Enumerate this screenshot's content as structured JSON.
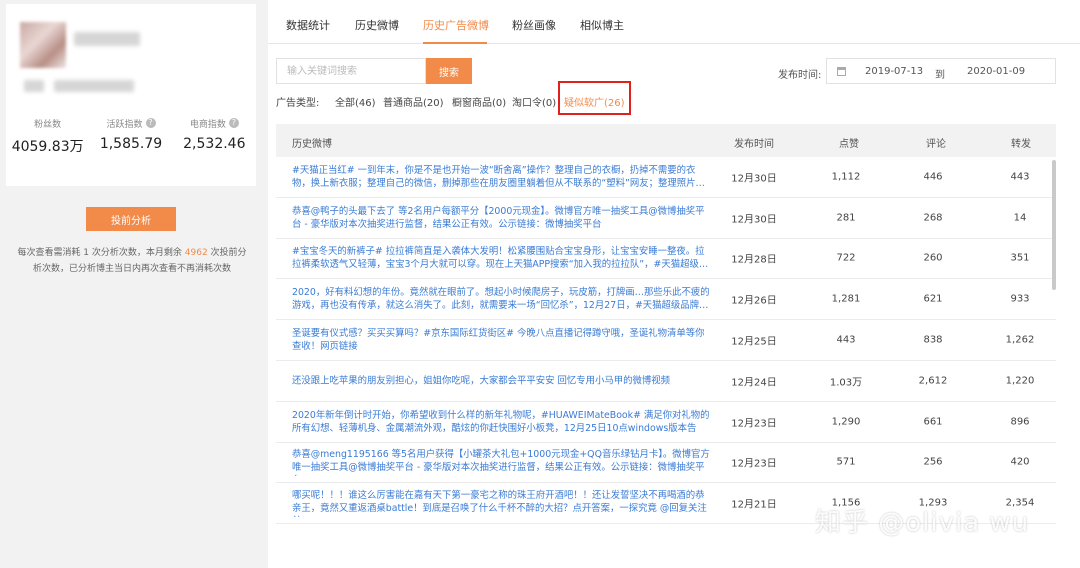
{
  "profile": {
    "stats": [
      {
        "label": "粉丝数",
        "value": "4059.83万"
      },
      {
        "label": "活跃指数",
        "value": "1,585.79"
      },
      {
        "label": "电商指数",
        "value": "2,532.46"
      }
    ],
    "analyze_button": "投前分析",
    "note_before": "每次查看需消耗 1 次分析次数，本月剩余",
    "note_remaining": "4962",
    "note_after": "次投前分析次数，已分析博主当日内再次查看不再消耗次数"
  },
  "tabs": [
    {
      "label": "数据统计",
      "active": false
    },
    {
      "label": "历史微博",
      "active": false
    },
    {
      "label": "历史广告微博",
      "active": true
    },
    {
      "label": "粉丝画像",
      "active": false
    },
    {
      "label": "相似博主",
      "active": false
    }
  ],
  "search": {
    "placeholder": "输入关键词搜索",
    "button": "搜索"
  },
  "date_filter": {
    "label": "发布时间:",
    "from": "2019-07-13",
    "to_label": "到",
    "to": "2020-01-09"
  },
  "ad_filter": {
    "label": "广告类型:",
    "items": [
      {
        "label": "全部(46)",
        "active": false
      },
      {
        "label": "普通商品(20)",
        "active": false
      },
      {
        "label": "橱窗商品(0)",
        "active": false
      },
      {
        "label": "淘口令(0)",
        "active": false
      },
      {
        "label": "疑似软广(26)",
        "active": true
      }
    ]
  },
  "table": {
    "columns": [
      "历史微博",
      "发布时间",
      "点赞",
      "评论",
      "转发"
    ],
    "rows": [
      {
        "text": "#天猫正当红# 一到年末，你是不是也开始一波“断舍离”操作？整理自己的衣橱，扔掉不需要的衣物，换上新衣服；整理自己的微信，删掉那些在朋友圈里躺着但从不联系的“塑料”网友；整理照片…",
        "date": "12月30日",
        "likes": "1,112",
        "comments": "446",
        "reposts": "443"
      },
      {
        "text": "恭喜@鸭子的头最下去了 等2名用户每额平分【2000元现金】。微博官方唯一抽奖工具@微博抽奖平台 - 豪华版对本次抽奖进行监督，结果公正有效。公示链接：微博抽奖平台",
        "date": "12月30日",
        "likes": "281",
        "comments": "268",
        "reposts": "14"
      },
      {
        "text": "#宝宝冬天的新裤子# 拉拉裤简直是入袭体大发明！松紧腰围贴合宝宝身形，让宝宝安睡一整夜。拉拉裤柔软透气又轻薄，宝宝3个月大就可以穿。现在上天猫APP搜索“加入我的拉拉队”，#天猫超级…",
        "date": "12月28日",
        "likes": "722",
        "comments": "260",
        "reposts": "351"
      },
      {
        "text": "2020，好有料幻想的年份。竟然就在眼前了。想起小时候爬房子，玩皮筋，打牌画…那些乐此不疲的游戏，再也没有传承，就这么消失了。此刻，就需要来一场“回忆杀”，12月27日，#天猫超级品牌…",
        "date": "12月26日",
        "likes": "1,281",
        "comments": "621",
        "reposts": "933"
      },
      {
        "text": "圣诞要有仪式感？买买买算吗？#京东国际红货街区# 今晚八点直播记得蹲守哦，圣诞礼物清单等你查收！网页链接",
        "date": "12月25日",
        "likes": "443",
        "comments": "838",
        "reposts": "1,262"
      },
      {
        "text": "还没跟上吃苹果的朋友别担心，姐姐你吃呢，大家都会平平安安 回忆专用小马甲的微博视频",
        "date": "12月24日",
        "likes": "1.03万",
        "comments": "2,612",
        "reposts": "1,220"
      },
      {
        "text": "2020年新年倒计时开始，你希望收到什么样的新年礼物呢，#HUAWEIMateBook# 满足你对礼物的所有幻想、轻薄机身、金属潮流外观，酷炫的你赶快围好小板凳，12月25日10点windows版本告",
        "date": "12月23日",
        "likes": "1,290",
        "comments": "661",
        "reposts": "896"
      },
      {
        "text": "恭喜@meng1195166 等5名用户获得【小罐茶大礼包+1000元现金+QQ音乐绿钻月卡】。微博官方唯一抽奖工具@微博抽奖平台 - 豪华版对本次抽奖进行监督，结果公正有效。公示链接：微博抽奖平台",
        "date": "12月23日",
        "likes": "571",
        "comments": "256",
        "reposts": "420"
      },
      {
        "text": "哪买呢！！！谁这么厉害能在嘉有天下第一豪宅之称的珠王府开酒吧！！还让发誓坚决不再喝酒的恭亲王，竟然又重返酒桌battle！到底是召唤了什么千杯不醉的大招？点开答案，一探究竟 @回复关注并…",
        "date": "12月21日",
        "likes": "1,156",
        "comments": "1,293",
        "reposts": "2,354"
      }
    ]
  },
  "watermark": "知乎 @olivia wu"
}
